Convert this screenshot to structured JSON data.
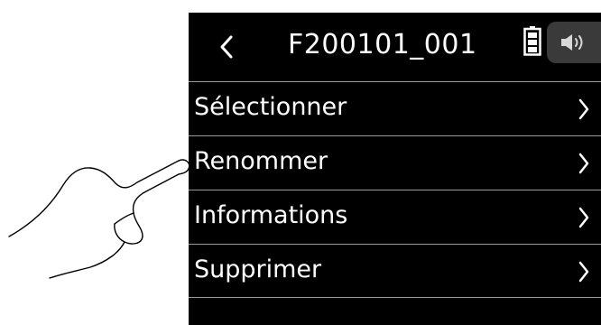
{
  "header": {
    "title": "F200101_001",
    "back_icon": "chevron-left-icon",
    "battery_icon": "battery-icon",
    "speaker_icon": "speaker-icon"
  },
  "menu": {
    "items": [
      {
        "label": "Sélectionner",
        "icon": "chevron-right-icon"
      },
      {
        "label": "Renommer",
        "icon": "chevron-right-icon"
      },
      {
        "label": "Informations",
        "icon": "chevron-right-icon"
      },
      {
        "label": "Supprimer",
        "icon": "chevron-right-icon"
      }
    ]
  },
  "colors": {
    "screen_background": "#000000",
    "text": "#ffffff",
    "divider": "#9a9a9a",
    "speaker_button": "#3a3a3a"
  }
}
